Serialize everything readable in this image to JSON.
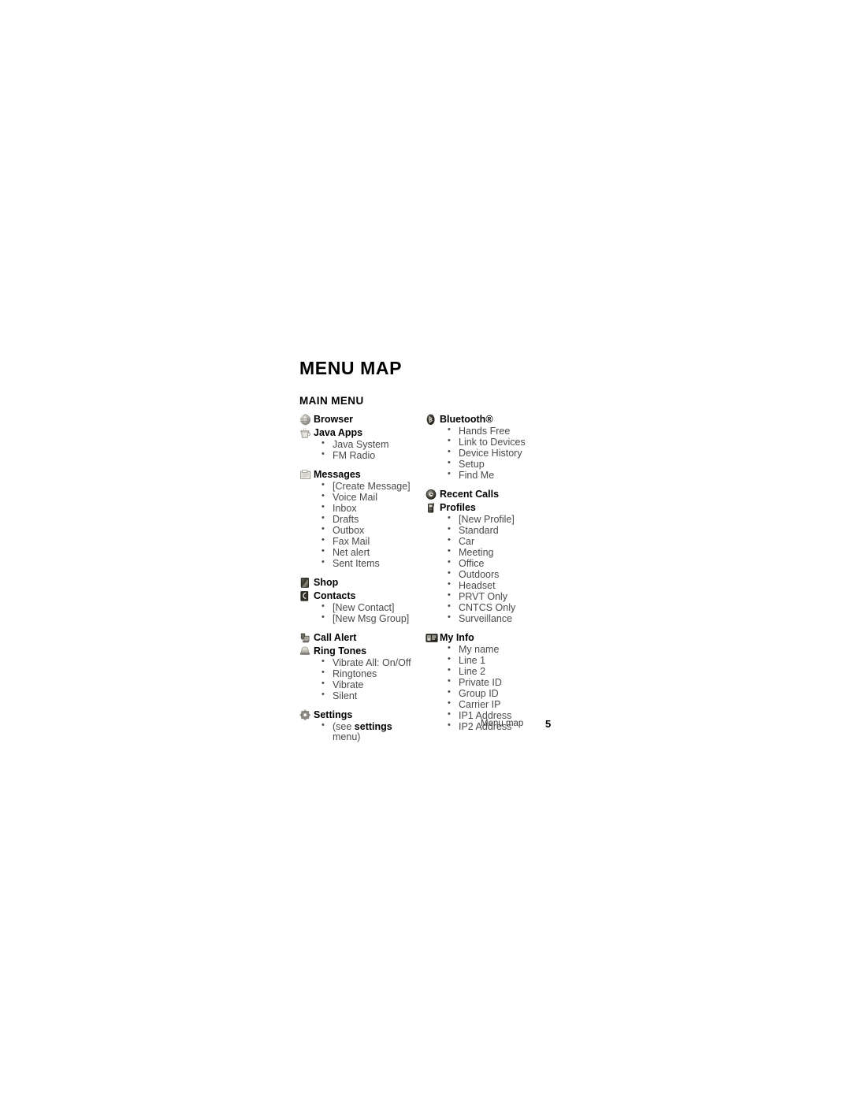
{
  "page": {
    "title": "MENU MAP",
    "section_title": "MAIN MENU",
    "footer_text": "Menu map",
    "footer_page_number": "5",
    "text_color": "#4a4a48",
    "heading_color": "#000000"
  },
  "left_column": [
    {
      "label": "Browser",
      "icon": "globe-icon",
      "items": []
    },
    {
      "label": "Java Apps",
      "icon": "coffee-cup-icon",
      "items": [
        "Java System",
        "FM Radio"
      ]
    },
    {
      "label": "Messages",
      "icon": "envelope-icon",
      "items": [
        "[Create Message]",
        "Voice Mail",
        "Inbox",
        "Drafts",
        "Outbox",
        "Fax Mail",
        "Net alert",
        "Sent Items"
      ]
    },
    {
      "label": "Shop",
      "icon": "shopping-bag-icon",
      "items": []
    },
    {
      "label": "Contacts",
      "icon": "contacts-card-icon",
      "items": [
        "[New Contact]",
        "[New Msg Group]"
      ]
    },
    {
      "label": "Call Alert",
      "icon": "call-alert-icon",
      "items": []
    },
    {
      "label": "Ring Tones",
      "icon": "bell-icon",
      "items": [
        "Vibrate All: On/Off",
        "Ringtones",
        "Vibrate",
        "Silent"
      ]
    },
    {
      "label": "Settings",
      "icon": "gear-icon",
      "items": [],
      "note_prefix": "(see ",
      "note_bold": "settings",
      "note_suffix": "menu)"
    }
  ],
  "right_column": [
    {
      "label": "Bluetooth®",
      "icon": "bluetooth-icon",
      "items": [
        "Hands Free",
        "Link to Devices",
        "Device History",
        "Setup",
        "Find Me"
      ]
    },
    {
      "label": "Recent Calls",
      "icon": "recent-calls-icon",
      "items": []
    },
    {
      "label": "Profiles",
      "icon": "profiles-phone-icon",
      "items": [
        "[New Profile]",
        "Standard",
        "Car",
        "Meeting",
        "Office",
        "Outdoors",
        "Headset",
        "PRVT Only",
        "CNTCS Only",
        "Surveillance"
      ]
    },
    {
      "label": "My Info",
      "icon": "id-card-icon",
      "items": [
        "My name",
        "Line 1",
        "Line 2",
        "Private ID",
        "Group ID",
        "Carrier IP",
        "IP1 Address",
        "IP2 Address"
      ]
    }
  ]
}
